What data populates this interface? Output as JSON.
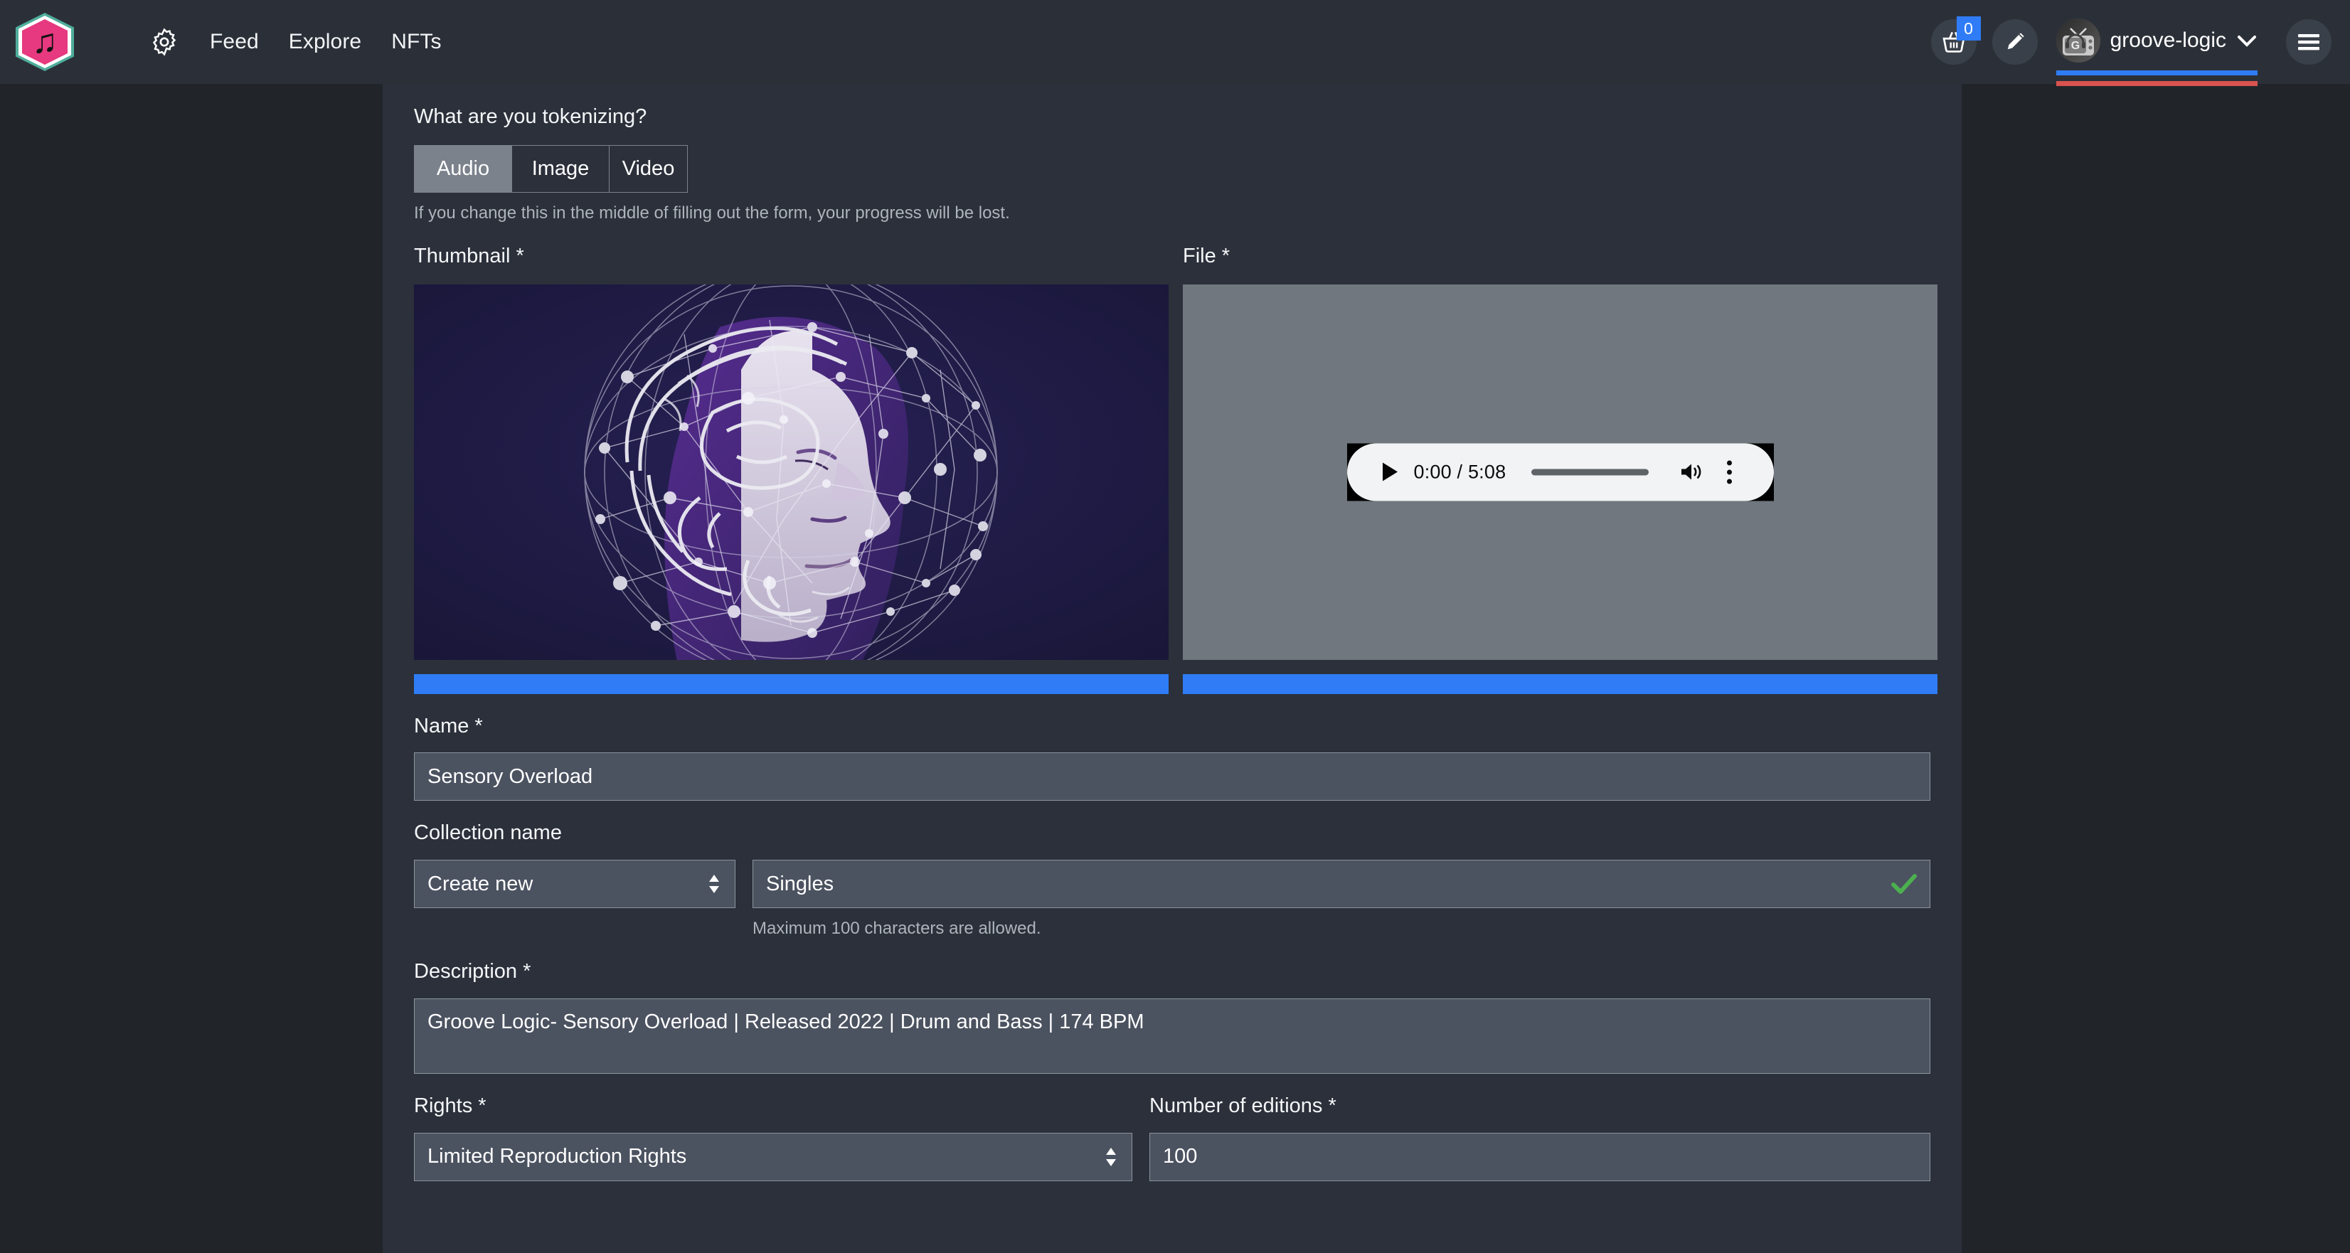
{
  "header": {
    "logo_icon": "music-note-hexagon-logo",
    "logo_glyph": "♫",
    "gear_icon": "gear-icon",
    "nav": [
      {
        "label": "Feed"
      },
      {
        "label": "Explore"
      },
      {
        "label": "NFTs"
      }
    ],
    "basket_icon": "basket-icon",
    "basket_badge": "0",
    "edit_icon": "pencil-icon",
    "avatar_icon": "user-avatar-retro-tv",
    "username": "groove-logic",
    "chevron_icon": "chevron-down-icon",
    "menu_icon": "hamburger-menu-icon",
    "underline_blue": "#2f7cf6",
    "underline_red": "#d9534f"
  },
  "form": {
    "type_question": "What are you tokenizing?",
    "type_options": [
      {
        "label": "Audio",
        "selected": true
      },
      {
        "label": "Image",
        "selected": false
      },
      {
        "label": "Video",
        "selected": false
      }
    ],
    "type_help": "If you change this in the middle of filling out the form, your progress will be lost.",
    "thumbnail_label": "Thumbnail *",
    "thumbnail_alt": "ai-brain-network-face-artwork",
    "file_label": "File *",
    "audio": {
      "play_icon": "play-icon",
      "timecode": "0:00 / 5:08",
      "volume_icon": "volume-icon",
      "menu_icon": "kebab-menu-icon"
    },
    "thumbnail_progress": "100",
    "file_progress": "100",
    "name_label": "Name *",
    "name_value": "Sensory Overload",
    "collection_label": "Collection name",
    "collection_select_value": "Create new",
    "collection_name_value": "Singles",
    "collection_valid_icon": "green-check-icon",
    "collection_help": "Maximum 100 characters are allowed.",
    "description_label": "Description *",
    "description_value": "Groove Logic- Sensory Overload | Released 2022 | Drum and Bass | 174 BPM",
    "rights_label": "Rights *",
    "rights_value": "Limited Reproduction Rights",
    "editions_label": "Number of editions *",
    "editions_value": "100"
  },
  "colors": {
    "accent_blue": "#2f7cf6",
    "valid_green": "#4caf50",
    "logo_pink": "#e6397f",
    "logo_teal": "#4fae9b",
    "panel_bg": "#2b303a",
    "page_bg": "#212529",
    "field_bg": "#4b5260"
  }
}
